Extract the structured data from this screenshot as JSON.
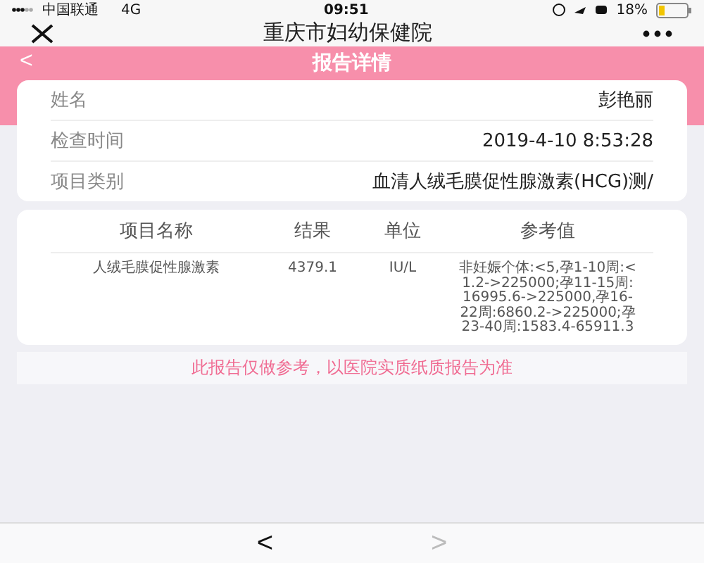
{
  "status_bar": {
    "carrier": "中国联通",
    "network": "4G",
    "time": "09:51",
    "battery": "18%"
  },
  "nav_bar": {
    "title": "重庆市妇幼保健院"
  },
  "header": {
    "back": "<",
    "title": "报告详情"
  },
  "info": [
    {
      "label": "姓名",
      "value": "彭艳丽"
    },
    {
      "label": "检查时间",
      "value": "2019-4-10 8:53:28"
    },
    {
      "label": "项目类别",
      "value": "血清人绒毛膜促性腺激素(HCG)测/"
    }
  ],
  "table": {
    "columns": [
      "项目名称",
      "结果",
      "单位",
      "参考值"
    ],
    "rows": [
      [
        "人绒毛膜促性腺激素",
        "4379.1",
        "IU/L",
        "非妊娠个体:<5,孕1-10周:<1.2->225000;孕11-15周: 16995.6->225000,孕16-22周:6860.2->225000;孕23-40周:1583.4-65911.3"
      ]
    ]
  },
  "notice": "此报告仅做参考，以医院实质纸质报告为准",
  "toolbar": [
    {
      "label": "<",
      "disabled": false
    },
    {
      "label": ">",
      "disabled": true
    }
  ]
}
